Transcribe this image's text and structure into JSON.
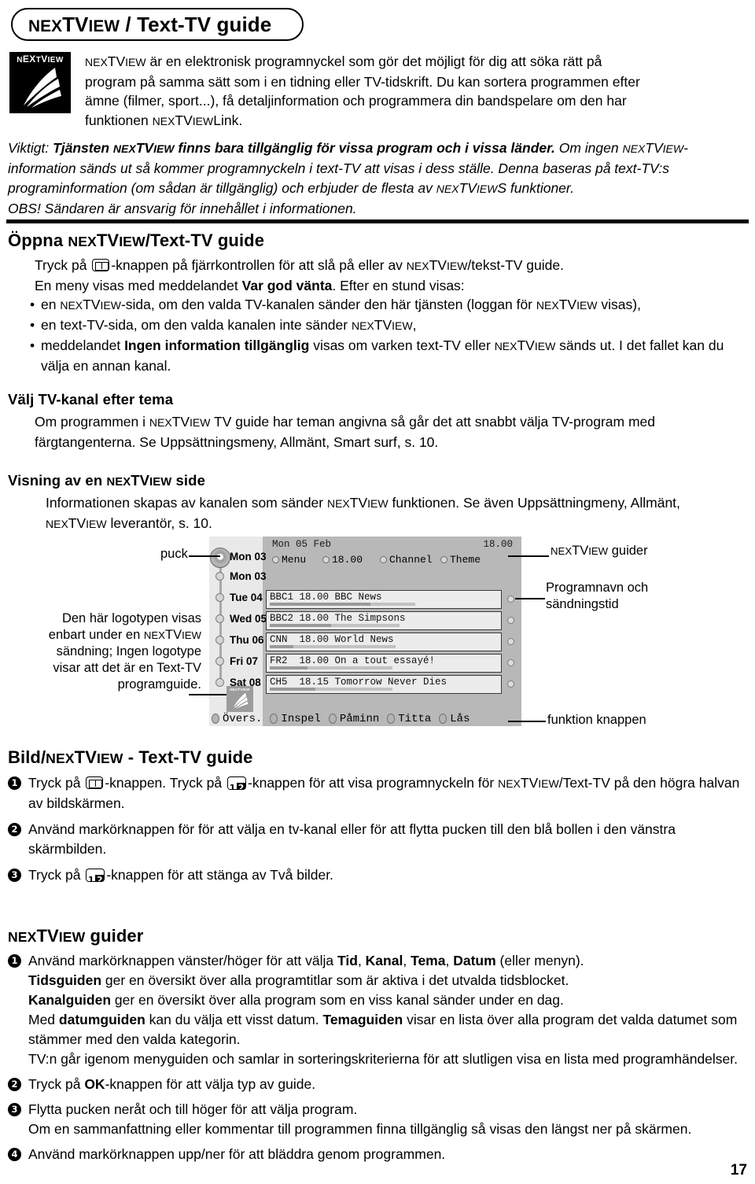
{
  "title": "NEXTVIEW / Text-TV guide",
  "logo": {
    "text": "NEXTVIEW"
  },
  "intro": {
    "line1": "NEXTVIEW är en elektronisk programnyckel som gör det möjligt för dig att söka rätt på",
    "line2": "program på samma sätt som i en tidning eller TV-tidskrift. Du kan sortera programmen efter",
    "line3": "ämne (filmer, sport...), få detaljinformation och programmera din bandspelare om den har",
    "line4": "funktionen NEXTVIEWLink."
  },
  "note": {
    "lead": "Viktigt:",
    "bold": "Tjänsten NEXTVIEW finns bara tillgänglig för vissa program och i vissa länder.",
    "rest1": "Om ingen NEXTVIEW-information sänds ut så kommer programnyckeln i text-TV att visas i dess ställe. Denna baseras på text-TV:s programinformation (om sådan är tillgänglig) och erbjuder de flesta av NEXTVIEWS funktioner.",
    "rest2": "OBS! Sändaren är ansvarig för innehållet i informationen."
  },
  "section_open": {
    "heading": "Öppna NEXTVIEW/Text-TV guide",
    "line1_a": "Tryck på",
    "line1_b": "-knappen på fjärrkontrollen för att slå på eller av NEXTVIEW/tekst-TV guide.",
    "line2_a": "En meny visas med meddelandet",
    "line2_bold": "Var god vänta",
    "line2_b": ". Efter en stund visas:",
    "bullets": [
      "en NEXTVIEW-sida, om den valda TV-kanalen sänder den här tjänsten (loggan för NEXTVIEW visas),",
      "en text-TV-sida, om den valda kanalen inte sänder NEXTVIEW,"
    ],
    "bullet3_a": "meddelandet",
    "bullet3_bold": "Ingen information tillgänglig",
    "bullet3_b": "visas om varken text-TV eller NEXTVIEW sänds ut. I det fallet kan du välja en annan kanal."
  },
  "section_theme": {
    "heading": "Välj TV-kanal efter tema",
    "body": "Om programmen i NEXTVIEW TV guide har teman angivna så går det att snabbt välja TV-program med färgtangenterna. Se Uppsättningsmeny, Allmänt, Smart surf, s. 10."
  },
  "section_view": {
    "heading": "Visning av en NEXTVIEW side",
    "body": "Informationen skapas av kanalen som sänder NEXTVIEW funktionen. Se även Uppsättningmeny, Allmänt, NEXTVIEW leverantör, s. 10."
  },
  "diagram": {
    "callout_puck": "puck",
    "callout_logo": "Den här logotypen visas enbart under en NEXTVIEW sändning; Ingen logotype visar att det är en Text-TV programguide.",
    "callout_guider": "NEXTVIEW guider",
    "callout_prog": "Programnavn och sändningstid",
    "callout_func": "funktion knappen",
    "screen": {
      "date": "Mon 05 Feb",
      "clock": "18.00",
      "menu_items": [
        "Menu",
        "18.00",
        "Channel",
        "Theme"
      ],
      "days": [
        "Mon 03",
        "Mon 03",
        "Tue 04",
        "Wed 05",
        "Thu 06",
        "Fri 07",
        "Sat 08"
      ],
      "programs": [
        {
          "channel": "BBC1",
          "time": "18.00",
          "name": "BBC News",
          "progress": 60,
          "progress2": 78
        },
        {
          "channel": "BBC2",
          "time": "18.00",
          "name": "The Simpsons",
          "progress": 38,
          "progress2": 72
        },
        {
          "channel": "CNN",
          "time": "18.00",
          "name": "World News",
          "progress": 14,
          "progress2": 70
        },
        {
          "channel": "FR2",
          "time": "18.00",
          "name": "On a tout essayé!",
          "progress": 22,
          "progress2": 68
        },
        {
          "channel": "CH5",
          "time": "18.15",
          "name": "Tomorrow Never Dies",
          "progress": 27,
          "progress2": 68
        }
      ],
      "function_buttons": [
        "Övers.",
        "Inspel",
        "Påminn",
        "Titta",
        "Lås"
      ],
      "logo_text": "NEXTVIEW"
    }
  },
  "section_bild": {
    "heading": "Bild/NEXTVIEW - Text-TV guide",
    "steps": [
      {
        "n": "1",
        "a": "Tryck på",
        "b": "-knappen. Tryck på",
        "c": "-knappen för att visa programnyckeln för NEXTVIEW/Text-TV på den högra halvan av bildskärmen."
      },
      {
        "n": "2",
        "text": "Använd markörknappen för för att välja en tv-kanal eller för att flytta pucken till den blå bollen i den vänstra skärmbilden."
      },
      {
        "n": "3",
        "a": "Tryck på",
        "b": "-knappen för att stänga av Två bilder."
      }
    ]
  },
  "section_guider": {
    "heading": "NEXTVIEW guider",
    "step1": {
      "n": "1",
      "l1_a": "Använd markörknappen vänster/höger för att välja",
      "l1_b": "Tid, Kanal, Tema, Datum",
      "l1_c": "(eller menyn).",
      "l2_bold": "Tidsguiden",
      "l2": "ger en översikt över alla programtitlar som är aktiva i det utvalda tidsblocket.",
      "l3_bold": "Kanalguiden",
      "l3": "ger en översikt över alla program som en viss kanal sänder under en dag.",
      "l4_a": "Med",
      "l4_bold1": "datumguiden",
      "l4_b": "kan du välja ett visst datum.",
      "l4_bold2": "Temaguiden",
      "l4_c": "visar en lista över alla program det valda datumet som stämmer med den valda kategorin.",
      "l5": "TV:n går igenom menyguiden och samlar in sorteringskriterierna för att slutligen visa en lista med programhändelser."
    },
    "step2": {
      "n": "2",
      "a": "Tryck på",
      "bold": "OK",
      "b": "-knappen för att välja typ av guide."
    },
    "step3": {
      "n": "3",
      "l1": "Flytta pucken neråt och till höger för att välja program.",
      "l2": "Om en sammanfattning eller kommentar till programmen finna tillgänglig så visas den längst ner på skärmen."
    },
    "step4": {
      "n": "4",
      "text": "Använd markörknappen upp/ner för att bläddra genom programmen."
    }
  },
  "page_number": "17"
}
